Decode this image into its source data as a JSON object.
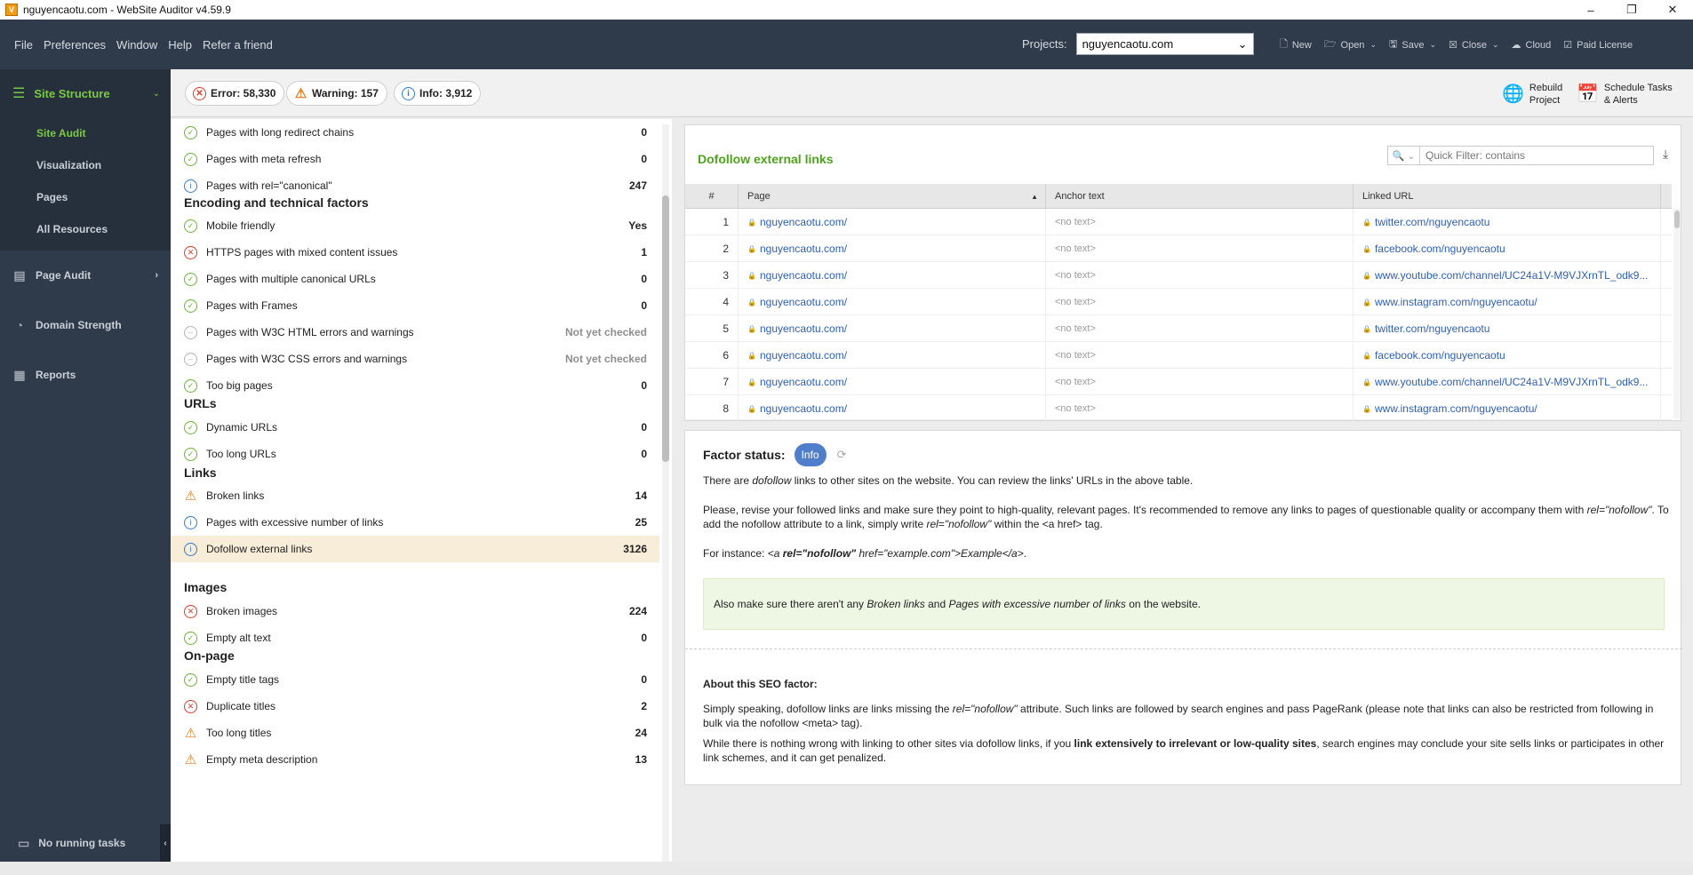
{
  "window": {
    "title": "nguyencaotu.com - WebSite Auditor v4.59.9",
    "app_icon": "V",
    "min": "–",
    "max": "❐",
    "close": "✕"
  },
  "menu": {
    "file": "File",
    "preferences": "Preferences",
    "window": "Window",
    "help": "Help",
    "refer": "Refer a friend"
  },
  "projects": {
    "label": "Projects:",
    "value": "nguyencaotu.com"
  },
  "toolbar": {
    "new": "New",
    "open": "Open",
    "save": "Save",
    "close": "Close",
    "cloud": "Cloud",
    "paid": "Paid License"
  },
  "sidebar": {
    "site_structure": "Site Structure",
    "site_audit": "Site Audit",
    "visualization": "Visualization",
    "pages": "Pages",
    "all_resources": "All Resources",
    "page_audit": "Page Audit",
    "domain_strength": "Domain Strength",
    "reports": "Reports",
    "no_tasks": "No running tasks"
  },
  "status": {
    "error": "Error: 58,330",
    "warning": "Warning: 157",
    "info": "Info: 3,912",
    "rebuild_1": "Rebuild",
    "rebuild_2": "Project",
    "schedule_1": "Schedule Tasks",
    "schedule_2": "& Alerts"
  },
  "factors": {
    "r1": {
      "label": "Pages with long redirect chains",
      "value": "0"
    },
    "r2": {
      "label": "Pages with meta refresh",
      "value": "0"
    },
    "r3": {
      "label": "Pages with rel=\"canonical\"",
      "value": "247"
    },
    "h_encoding": "Encoding and technical factors",
    "r4": {
      "label": "Mobile friendly",
      "value": "Yes"
    },
    "r5": {
      "label": "HTTPS pages with mixed content issues",
      "value": "1"
    },
    "r6": {
      "label": "Pages with multiple canonical URLs",
      "value": "0"
    },
    "r7": {
      "label": "Pages with Frames",
      "value": "0"
    },
    "r8": {
      "label": "Pages with W3C HTML errors and warnings",
      "value": "Not yet checked"
    },
    "r9": {
      "label": "Pages with W3C CSS errors and warnings",
      "value": "Not yet checked"
    },
    "r10": {
      "label": "Too big pages",
      "value": "0"
    },
    "h_urls": "URLs",
    "r11": {
      "label": "Dynamic URLs",
      "value": "0"
    },
    "r12": {
      "label": "Too long URLs",
      "value": "0"
    },
    "h_links": "Links",
    "r13": {
      "label": "Broken links",
      "value": "14"
    },
    "r14": {
      "label": "Pages with excessive number of links",
      "value": "25"
    },
    "r15": {
      "label": "Dofollow external links",
      "value": "3126"
    },
    "h_images": "Images",
    "r16": {
      "label": "Broken images",
      "value": "224"
    },
    "r17": {
      "label": "Empty alt text",
      "value": "0"
    },
    "h_onpage": "On-page",
    "r18": {
      "label": "Empty title tags",
      "value": "0"
    },
    "r19": {
      "label": "Duplicate titles",
      "value": "2"
    },
    "r20": {
      "label": "Too long titles",
      "value": "24"
    },
    "r21": {
      "label": "Empty meta description",
      "value": "13"
    }
  },
  "table": {
    "title": "Dofollow external links",
    "filter_placeholder": "Quick Filter: contains",
    "col_num": "#",
    "col_page": "Page",
    "col_anchor": "Anchor text",
    "col_url": "Linked URL",
    "rows": [
      {
        "n": "1",
        "page": "nguyencaotu.com/",
        "anchor": "<no text>",
        "url": "twitter.com/nguyencaotu"
      },
      {
        "n": "2",
        "page": "nguyencaotu.com/",
        "anchor": "<no text>",
        "url": "facebook.com/nguyencaotu"
      },
      {
        "n": "3",
        "page": "nguyencaotu.com/",
        "anchor": "<no text>",
        "url": "www.youtube.com/channel/UC24a1V-M9VJXrnTL_odk9..."
      },
      {
        "n": "4",
        "page": "nguyencaotu.com/",
        "anchor": "<no text>",
        "url": "www.instagram.com/nguyencaotu/"
      },
      {
        "n": "5",
        "page": "nguyencaotu.com/",
        "anchor": "<no text>",
        "url": "twitter.com/nguyencaotu"
      },
      {
        "n": "6",
        "page": "nguyencaotu.com/",
        "anchor": "<no text>",
        "url": "facebook.com/nguyencaotu"
      },
      {
        "n": "7",
        "page": "nguyencaotu.com/",
        "anchor": "<no text>",
        "url": "www.youtube.com/channel/UC24a1V-M9VJXrnTL_odk9..."
      },
      {
        "n": "8",
        "page": "nguyencaotu.com/",
        "anchor": "<no text>",
        "url": "www.instagram.com/nguyencaotu/"
      }
    ]
  },
  "desc": {
    "factor_status": "Factor status:",
    "badge": "Info",
    "p1a": "There are ",
    "p1b": "dofollow",
    "p1c": " links to other sites on the website. You can review the links' URLs in the above table.",
    "p2a": "Please, revise your followed links and make sure they point to high-quality, relevant pages. It's recommended to remove any links to pages of questionable quality or accompany them with ",
    "p2b": "rel=\"nofollow\"",
    "p2c": ". To add the nofollow attribute to a link, simply write ",
    "p2d": "rel=\"nofollow\"",
    "p2e": " within the <a href> tag.",
    "p3a": "For instance: ",
    "p3b": "<a ",
    "p3c": "rel=\"nofollow\"",
    "p3d": " href=\"example.com\">Example</a>",
    "p3e": ".",
    "g1": "Also make sure there aren't any ",
    "g2": "Broken links",
    "g3": " and ",
    "g4": "Pages with excessive number of links",
    "g5": " on the website.",
    "about_title": "About this SEO factor:",
    "a1a": "Simply speaking, dofollow links are links missing the ",
    "a1b": "rel=\"nofollow\"",
    "a1c": " attribute. Such links are followed by search engines and pass PageRank (please note that links can also be restricted from following in bulk via the nofollow <meta> tag).",
    "a2a": "While there is nothing wrong with linking to other sites via dofollow links, if you ",
    "a2b": "link extensively to irrelevant or low-quality sites",
    "a2c": ", search engines may conclude your site sells links or participates in other link schemes, and it can get penalized."
  }
}
